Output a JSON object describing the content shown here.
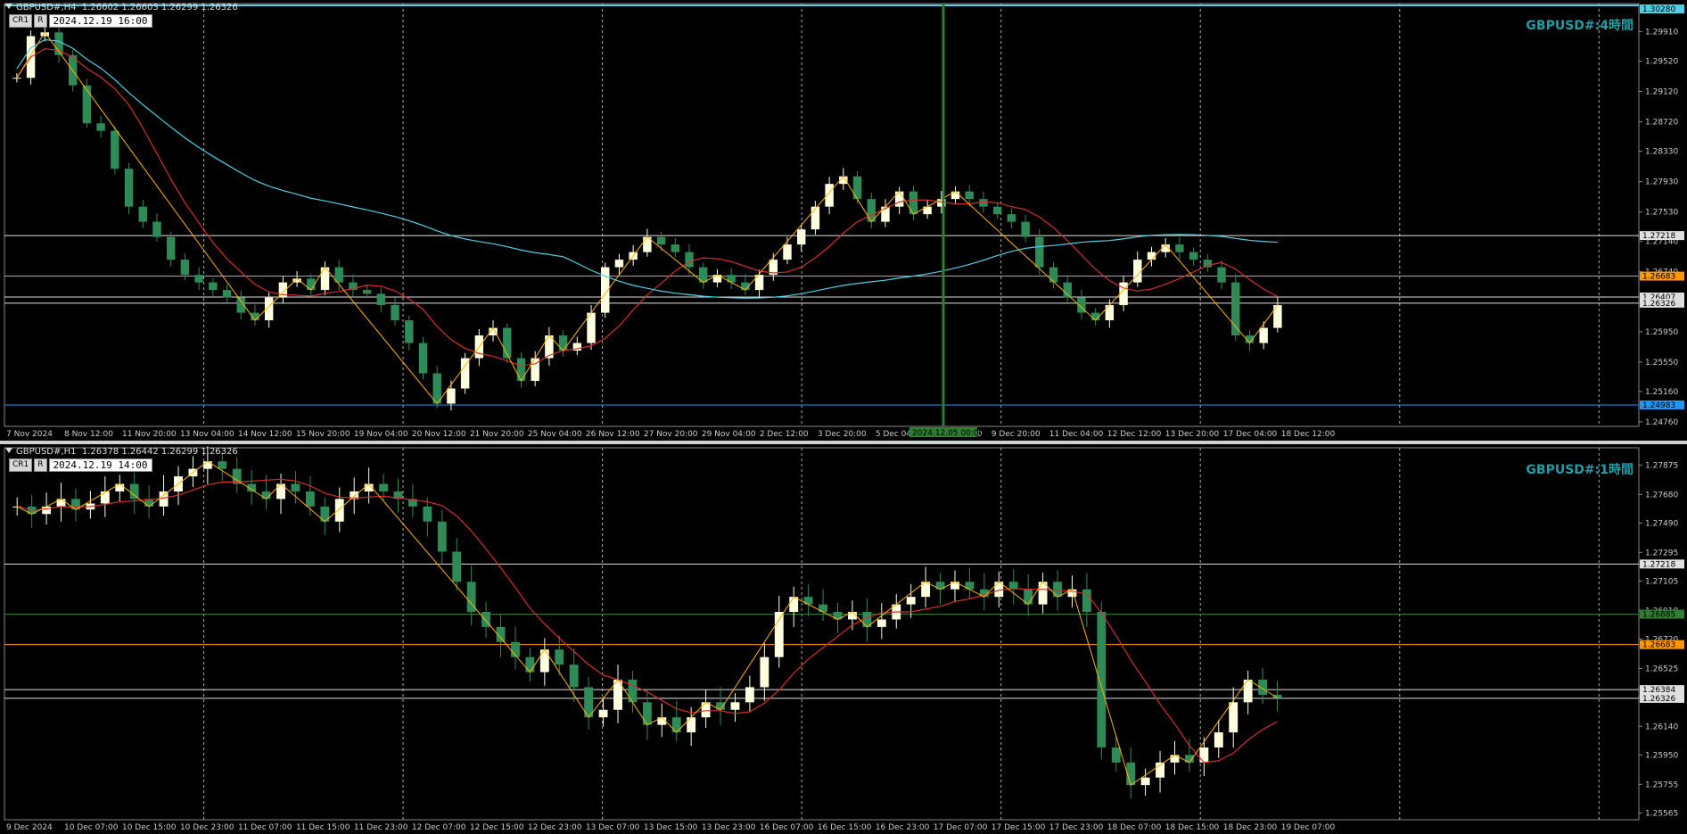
{
  "colors": {
    "background": "#000000",
    "bull": "#ffffe0",
    "bear": "#2e8b57",
    "ma_fast": "#d32f2f",
    "ma_slow": "#4dd0e1",
    "zigzag": "#ffb300",
    "level_white": "#e0e0e0",
    "level_orange": "#ff9800",
    "level_blue": "#2196f3",
    "level_green": "#2e7d32",
    "watermark": "#1e9fa8"
  },
  "chart_data": [
    {
      "type": "candlestick",
      "symbol": "GBPUSD#,H4",
      "ohlc_text": "1.26602 1.26603 1.26299 1.26326",
      "cursor_date": "2024.12.19 16:00",
      "watermark": "GBPUSD#:4時間",
      "buttons": [
        "CR1",
        "R"
      ],
      "y_ticks": [
        "1.29910",
        "1.29520",
        "1.29120",
        "1.28720",
        "1.28330",
        "1.27930",
        "1.27530",
        "1.27140",
        "1.26740",
        "1.26340",
        "1.25950",
        "1.25550",
        "1.25160",
        "1.24760"
      ],
      "ylim": [
        1.247,
        1.3028
      ],
      "x_ticks": [
        "7 Nov 2024",
        "8 Nov 12:00",
        "11 Nov 20:00",
        "13 Nov 04:00",
        "14 Nov 12:00",
        "15 Nov 20:00",
        "19 Nov 04:00",
        "20 Nov 12:00",
        "21 Nov 20:00",
        "25 Nov 04:00",
        "26 Nov 12:00",
        "27 Nov 20:00",
        "29 Nov 04:00",
        "2 Dec 12:00",
        "3 Dec 20:00",
        "5 Dec 04:00",
        "6 Dec 12:00",
        "9 Dec 20:00",
        "11 Dec 04:00",
        "12 Dec 12:00",
        "13 Dec 20:00",
        "17 Dec 04:00",
        "18 Dec 12:00"
      ],
      "levels": [
        {
          "label": "1.30280",
          "price": 1.3028,
          "color": "#4dd0e1"
        },
        {
          "label": "1.27218",
          "price": 1.27218,
          "color": "#e0e0e0"
        },
        {
          "label": "1.26683",
          "price": 1.26683,
          "color": "#ff9800"
        },
        {
          "label": "1.26407",
          "price": 1.26407,
          "color": "#e0e0e0"
        },
        {
          "label": "1.26326",
          "price": 1.26326,
          "color": "#e0e0e0"
        },
        {
          "label": "1.24983",
          "price": 1.24983,
          "color": "#2196f3"
        }
      ],
      "vertical_marker_label": "2024.12.05 00:00",
      "close_path": [
        1.293,
        1.2985,
        1.299,
        1.296,
        1.292,
        1.287,
        1.286,
        1.281,
        1.276,
        1.274,
        1.272,
        1.269,
        1.267,
        1.266,
        1.265,
        1.264,
        1.262,
        1.261,
        1.264,
        1.266,
        1.2665,
        1.265,
        1.268,
        1.266,
        1.265,
        1.2645,
        1.263,
        1.261,
        1.258,
        1.254,
        1.25,
        1.252,
        1.256,
        1.259,
        1.26,
        1.256,
        1.253,
        1.256,
        1.259,
        1.257,
        1.258,
        1.262,
        1.268,
        1.269,
        1.27,
        1.272,
        1.271,
        1.27,
        1.268,
        1.266,
        1.267,
        1.266,
        1.265,
        1.267,
        1.269,
        1.271,
        1.273,
        1.276,
        1.279,
        1.28,
        1.277,
        1.274,
        1.276,
        1.278,
        1.275,
        1.276,
        1.277,
        1.278,
        1.277,
        1.276,
        1.275,
        1.274,
        1.272,
        1.268,
        1.266,
        1.264,
        1.262,
        1.261,
        1.263,
        1.266,
        1.269,
        1.27,
        1.271,
        1.27,
        1.269,
        1.268,
        1.266,
        1.259,
        1.258,
        1.26,
        1.263
      ]
    },
    {
      "type": "candlestick",
      "symbol": "GBPUSD#,H1",
      "ohlc_text": "1.26378 1.26442 1.26299 1.26326",
      "cursor_date": "2024.12.19 14:00",
      "watermark": "GBPUSD#:1時間",
      "buttons": [
        "CR1",
        "R"
      ],
      "y_ticks": [
        "1.27875",
        "1.27680",
        "1.27490",
        "1.27295",
        "1.27105",
        "1.26910",
        "1.26720",
        "1.26525",
        "1.26335",
        "1.26140",
        "1.25950",
        "1.25755",
        "1.25565"
      ],
      "ylim": [
        1.2552,
        1.2799
      ],
      "x_ticks": [
        "9 Dec 2024",
        "10 Dec 07:00",
        "10 Dec 15:00",
        "10 Dec 23:00",
        "11 Dec 07:00",
        "11 Dec 15:00",
        "11 Dec 23:00",
        "12 Dec 07:00",
        "12 Dec 15:00",
        "12 Dec 23:00",
        "13 Dec 07:00",
        "13 Dec 15:00",
        "13 Dec 23:00",
        "16 Dec 07:00",
        "16 Dec 15:00",
        "16 Dec 23:00",
        "17 Dec 07:00",
        "17 Dec 15:00",
        "17 Dec 23:00",
        "18 Dec 07:00",
        "18 Dec 15:00",
        "18 Dec 23:00",
        "19 Dec 07:00"
      ],
      "levels": [
        {
          "label": "1.27218",
          "price": 1.27218,
          "color": "#e0e0e0"
        },
        {
          "label": "1.26885",
          "price": 1.26885,
          "color": "#2e7d32"
        },
        {
          "label": "1.26683",
          "price": 1.26683,
          "color": "#ff9800"
        },
        {
          "label": "1.26384",
          "price": 1.26384,
          "color": "#e0e0e0"
        },
        {
          "label": "1.26326",
          "price": 1.26326,
          "color": "#e0e0e0"
        }
      ],
      "close_path": [
        1.276,
        1.2755,
        1.276,
        1.2765,
        1.2758,
        1.2762,
        1.277,
        1.2775,
        1.2765,
        1.276,
        1.277,
        1.278,
        1.2785,
        1.279,
        1.2785,
        1.2775,
        1.277,
        1.2765,
        1.2775,
        1.277,
        1.276,
        1.275,
        1.2765,
        1.277,
        1.2775,
        1.277,
        1.2765,
        1.276,
        1.275,
        1.273,
        1.271,
        1.269,
        1.268,
        1.267,
        1.266,
        1.265,
        1.2665,
        1.2655,
        1.264,
        1.262,
        1.2625,
        1.2645,
        1.263,
        1.2615,
        1.262,
        1.261,
        1.262,
        1.263,
        1.2625,
        1.263,
        1.264,
        1.266,
        1.269,
        1.27,
        1.2695,
        1.269,
        1.2685,
        1.269,
        1.268,
        1.2685,
        1.2695,
        1.27,
        1.271,
        1.2705,
        1.271,
        1.2705,
        1.27,
        1.271,
        1.2705,
        1.2695,
        1.271,
        1.27,
        1.2705,
        1.269,
        1.26,
        1.259,
        1.2575,
        1.258,
        1.259,
        1.2595,
        1.259,
        1.26,
        1.261,
        1.263,
        1.2645,
        1.2635,
        1.2633
      ]
    }
  ]
}
